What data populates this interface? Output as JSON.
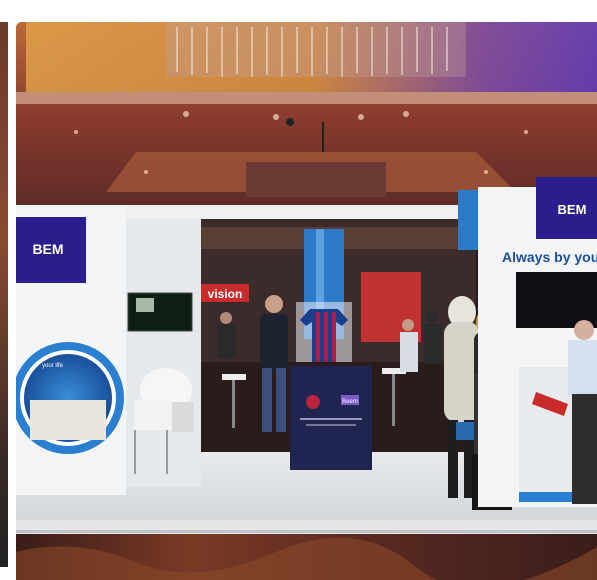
{
  "scene": {
    "left_booth_logo": "BEM",
    "right_booth_logo": "BEM",
    "right_booth_slogan": "Always by you",
    "back_wall_sign": "vision",
    "counter_logo": "Beem",
    "left_wall_panel_text": "your life"
  },
  "colors": {
    "logo_purple": "#2b1d8c",
    "floor_carpet": "#6b2a22",
    "ceiling_warm": "#d98a3a",
    "booth_white": "#f2f4f6",
    "accent_blue": "#1d6fc4"
  }
}
